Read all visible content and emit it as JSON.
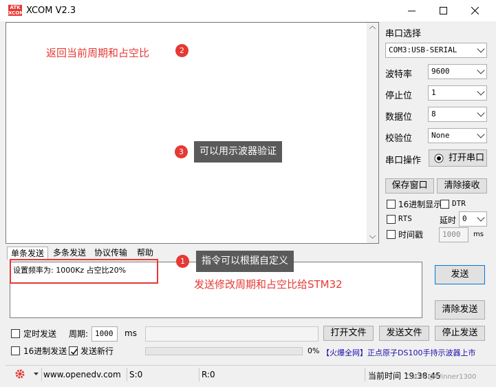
{
  "window": {
    "title": "XCOM V2.3",
    "logo_text": "ATK XCOM"
  },
  "annotations": {
    "recv_note": "返回当前周期和占空比",
    "badge_1": "1",
    "badge_2": "2",
    "badge_3": "3",
    "tip_scope": "可以用示波器验证",
    "tip_custom": "指令可以根据自定义",
    "send_note": "发送修改周期和占空比给STM32"
  },
  "serial": {
    "section_label": "串口选择",
    "port_value": "COM3:USB-SERIAL",
    "baud_label": "波特率",
    "baud_value": "9600",
    "stop_label": "停止位",
    "stop_value": "1",
    "data_label": "数据位",
    "data_value": "8",
    "parity_label": "校验位",
    "parity_value": "None",
    "op_label": "串口操作",
    "open_button": "打开串口",
    "save_button": "保存窗口",
    "clear_recv_button": "清除接收",
    "hex_display": "16进制显示",
    "dtr": "DTR",
    "rts": "RTS",
    "delay_label": "延时",
    "delay_value": "0",
    "timestamp": "时间戳",
    "timestamp_ms": "1000",
    "ms_unit": "ms"
  },
  "tabs": [
    "单条发送",
    "多条发送",
    "协议传输",
    "帮助"
  ],
  "send": {
    "text": "设置频率为: 1000Kz 占空比20%",
    "send_button": "发送",
    "clear_send_button": "清除发送",
    "timed_send": "定时发送",
    "period_label": "周期:",
    "period_value": "1000",
    "ms": "ms",
    "open_file_button": "打开文件",
    "send_file_button": "发送文件",
    "stop_send_button": "停止发送",
    "hex_send": "16进制发送",
    "new_line": "发送新行",
    "progress_text": "0%",
    "progress": 0,
    "ad_text": "【火爆全网】正点原子DS100手持示波器上市"
  },
  "status": {
    "url": "www.openedv.com",
    "s_count": "S:0",
    "r_count": "R:0",
    "time": "当前时间 19:38:45",
    "watermark": "CSDN @Winner1300"
  },
  "colors": {
    "accent": "#e53935",
    "link": "#1a0dab"
  }
}
